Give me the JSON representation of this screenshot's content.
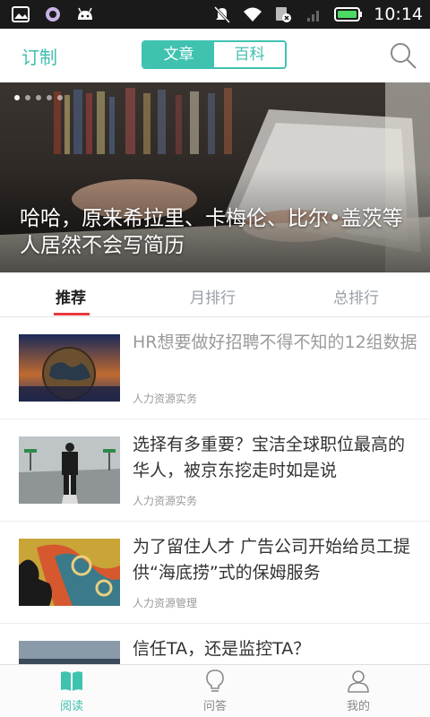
{
  "status_bar": {
    "time": "10:14"
  },
  "header": {
    "subscribe_label": "订制",
    "segments": [
      "文章",
      "百科"
    ]
  },
  "banner": {
    "title": "哈哈，原来希拉里、卡梅伦、比尔•盖茨等人居然不会写简历",
    "slide_count": 5
  },
  "tabs": [
    "推荐",
    "月排行",
    "总排行"
  ],
  "articles": [
    {
      "title": "HR想要做好招聘不得不知的12组数据",
      "tag": "人力资源实务",
      "read": true
    },
    {
      "title": "选择有多重要？宝洁全球职位最高的华人，被京东挖走时如是说",
      "tag": "人力资源实务",
      "read": false
    },
    {
      "title": "为了留住人才 广告公司开始给员工提供“海底捞”式的保姆服务",
      "tag": "人力资源管理",
      "read": false
    },
    {
      "title": "信任TA，还是监控TA？",
      "tag": "",
      "read": false
    }
  ],
  "bottom_nav": [
    {
      "label": "阅读",
      "icon": "book-icon",
      "active": true
    },
    {
      "label": "问答",
      "icon": "lightbulb-icon",
      "active": false
    },
    {
      "label": "我的",
      "icon": "person-icon",
      "active": false
    }
  ],
  "colors": {
    "accent": "#3fc2b0",
    "tab_indicator": "#e8383b",
    "status_bar": "#1a1a1a"
  }
}
